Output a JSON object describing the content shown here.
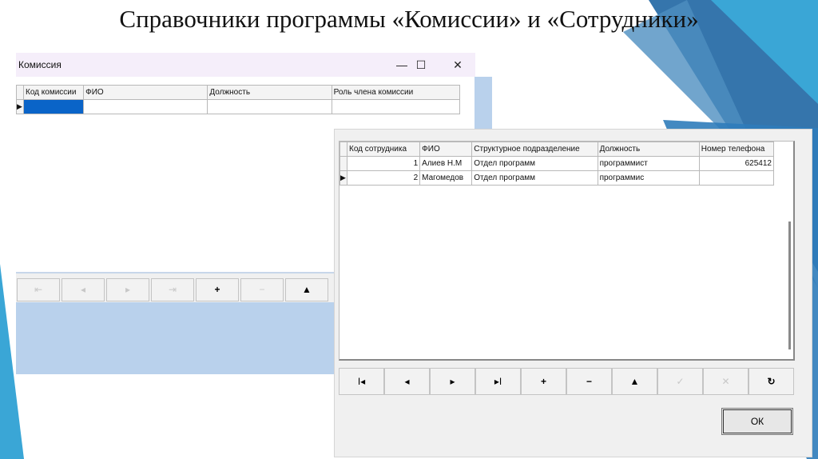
{
  "slide": {
    "title": "Справочники программы «Комиссии» и «Сотрудники»"
  },
  "window_commission": {
    "title": "Комиссия",
    "controls": {
      "minimize": "—",
      "maximize": "☐",
      "close": "✕"
    },
    "columns": [
      "Код комиссии",
      "ФИО",
      "Должность",
      "Роль члена комиссии"
    ],
    "rows": [
      [
        "",
        "",
        "",
        ""
      ]
    ],
    "nav": [
      "⇤",
      "◂",
      "▸",
      "⇥",
      "+",
      "−",
      "▲"
    ]
  },
  "window_employees": {
    "columns": [
      "Код сотрудника",
      "ФИО",
      "Структурное подразделение",
      "Должность",
      "Номер телефона"
    ],
    "rows": [
      [
        "1",
        "Алиев Н.М",
        "Отдел программ",
        "программист",
        "625412"
      ],
      [
        "2",
        "Магомедов",
        "Отдел программ",
        "программис",
        ""
      ]
    ],
    "nav": [
      "I◂",
      "◂",
      "▸",
      "▸I",
      "+",
      "−",
      "▲",
      "✓",
      "✕",
      "↻"
    ],
    "ok_label": "ОК"
  },
  "colors": {
    "accent_blue": "#2a7ab0",
    "teal": "#3aa0c8",
    "selection": "#0a64c8",
    "panel": "#b9d1ec"
  }
}
